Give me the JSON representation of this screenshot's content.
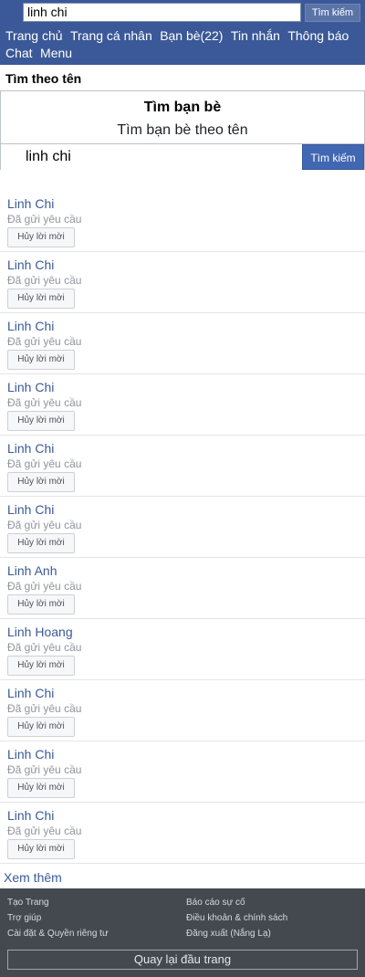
{
  "header": {
    "search_value": "linh chi",
    "search_button": "Tìm kiếm",
    "nav": [
      "Trang chủ",
      "Trang cá nhân",
      "Bạn bè(22)",
      "Tin nhắn",
      "Thông báo",
      "Chat",
      "Menu"
    ]
  },
  "section_title": "Tìm theo tên",
  "find": {
    "title": "Tìm bạn bè",
    "subtitle": "Tìm bạn bè theo tên",
    "input_value": "linh chi",
    "button": "Tìm kiếm"
  },
  "results": [
    {
      "name": "Linh Chi",
      "status": "Đã gửi yêu cầu",
      "action": "Hủy lời mời"
    },
    {
      "name": "Linh Chi",
      "status": "Đã gửi yêu cầu",
      "action": "Hủy lời mời"
    },
    {
      "name": "Linh Chi",
      "status": "Đã gửi yêu cầu",
      "action": "Hủy lời mời"
    },
    {
      "name": "Linh Chi",
      "status": "Đã gửi yêu cầu",
      "action": "Hủy lời mời"
    },
    {
      "name": "Linh Chi",
      "status": "Đã gửi yêu cầu",
      "action": "Hủy lời mời"
    },
    {
      "name": "Linh Chi",
      "status": "Đã gửi yêu cầu",
      "action": "Hủy lời mời"
    },
    {
      "name": "Linh Anh",
      "status": "Đã gửi yêu cầu",
      "action": "Hủy lời mời"
    },
    {
      "name": "Linh Hoang",
      "status": "Đã gửi yêu cầu",
      "action": "Hủy lời mời"
    },
    {
      "name": "Linh Chi",
      "status": "Đã gửi yêu cầu",
      "action": "Hủy lời mời"
    },
    {
      "name": "Linh Chi",
      "status": "Đã gửi yêu cầu",
      "action": "Hủy lời mời"
    },
    {
      "name": "Linh Chi",
      "status": "Đã gửi yêu cầu",
      "action": "Hủy lời mời"
    }
  ],
  "see_more": "Xem thêm",
  "footer": {
    "links": [
      "Tạo Trang",
      "Báo cáo sự cố",
      "Trợ giúp",
      "Điều khoản & chính sách",
      "Cài đặt & Quyền riêng tư",
      "Đăng xuất (Nắng Lạ)"
    ],
    "back_to_top": "Quay lại đầu trang"
  },
  "colors": {
    "brand": "#3b5998",
    "link": "#3b5998",
    "footer_bg": "#444950"
  }
}
